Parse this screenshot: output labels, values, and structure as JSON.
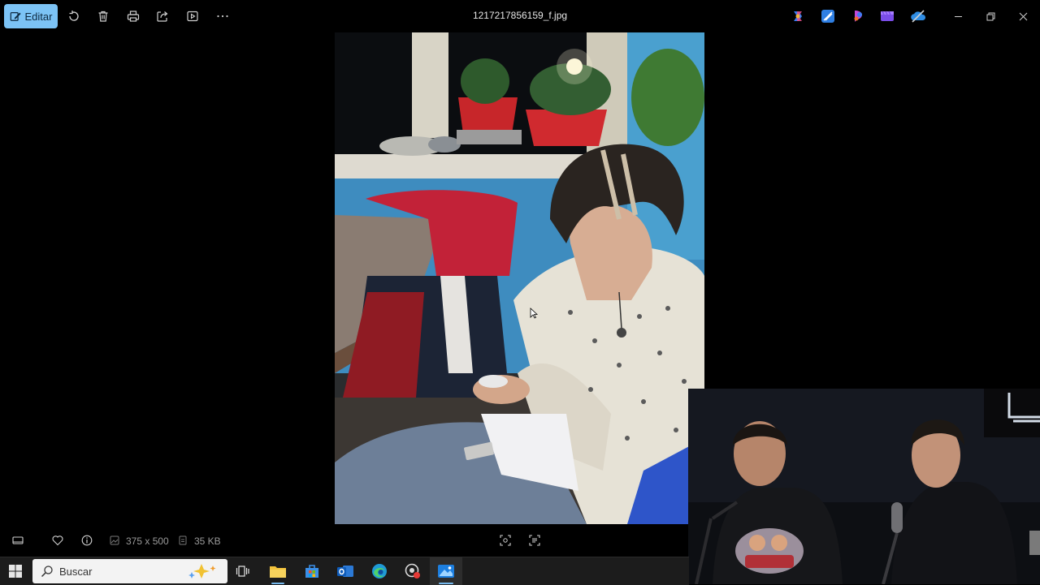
{
  "toolbar": {
    "edit_label": "Editar",
    "filename": "1217217856159_f.jpg",
    "icons": [
      "edit-icon",
      "rotate-icon",
      "delete-icon",
      "print-icon",
      "share-icon",
      "slideshow-icon",
      "more-icon"
    ],
    "app_icons": [
      "copilot-icon",
      "clipchamp-icon",
      "designer-icon",
      "clipchamp-video-icon",
      "onedrive-icon"
    ],
    "window_controls": [
      "minimize-icon",
      "restore-icon",
      "close-icon"
    ],
    "accent": "#7cc3f5"
  },
  "info": {
    "dimensions": "375 x 500",
    "size": "35 KB",
    "icons": [
      "filmstrip-icon",
      "favorite-icon",
      "info-icon",
      "dimensions-icon",
      "filesize-icon",
      "fit-icon",
      "ocr-icon"
    ]
  },
  "taskbar": {
    "search_placeholder": "Buscar",
    "apps": [
      "start-icon",
      "task-view-icon",
      "file-explorer-icon",
      "store-icon",
      "outlook-icon",
      "edge-icon",
      "record-icon",
      "photos-icon"
    ]
  }
}
